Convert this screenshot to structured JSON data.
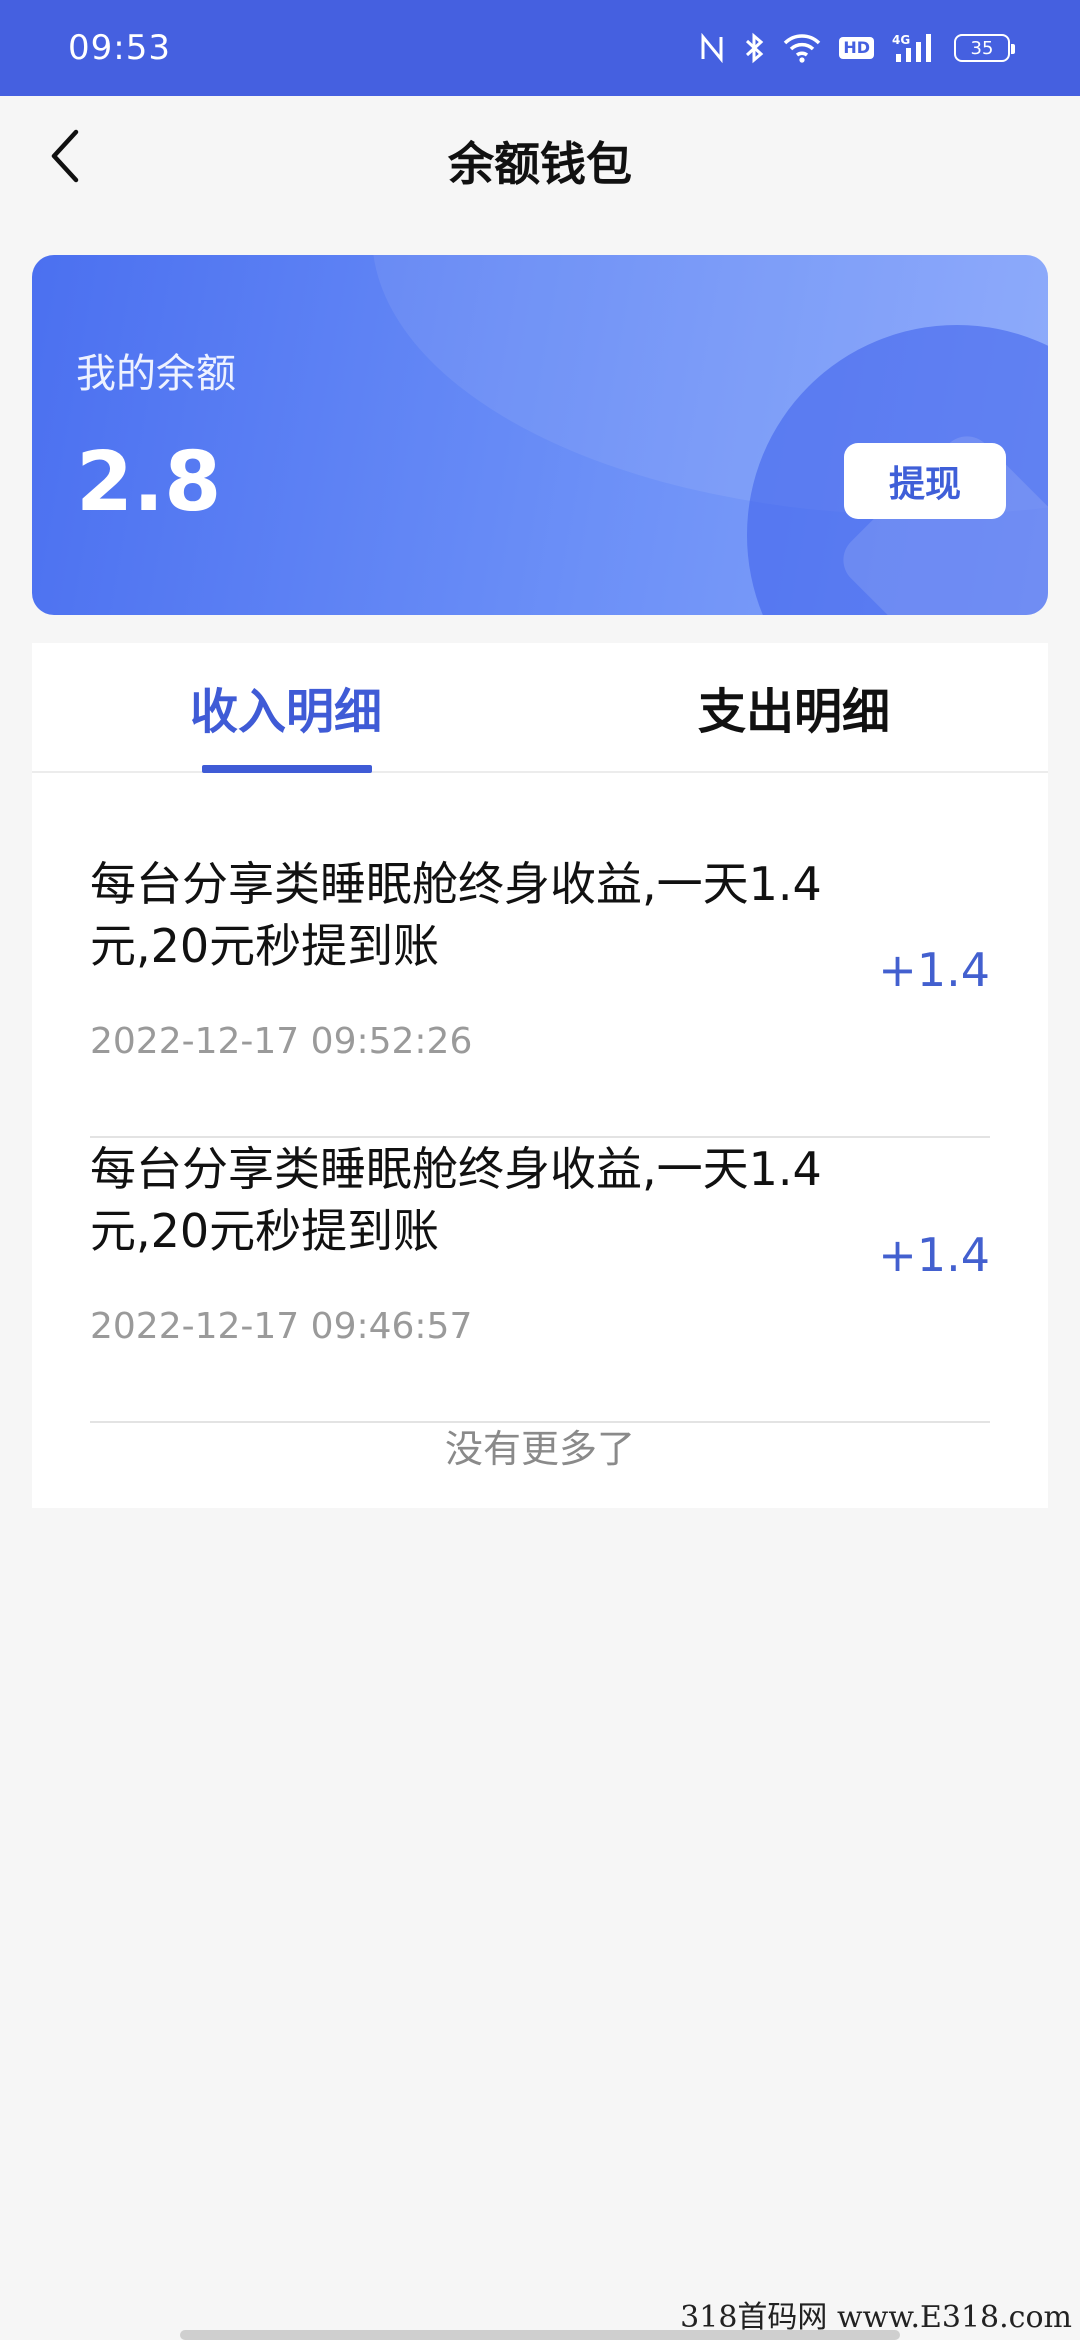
{
  "status_bar": {
    "time": "09:53",
    "icons": [
      "nfc-icon",
      "bluetooth-icon",
      "wifi-icon",
      "hd-icon",
      "signal-4g-icon",
      "battery-icon"
    ],
    "hd_label": "HD",
    "network_label": "4G",
    "battery_level": "35"
  },
  "header": {
    "title": "余额钱包",
    "back_icon": "chevron-left-icon"
  },
  "balance_card": {
    "label": "我的余额",
    "value": "2.8",
    "withdraw_label": "提现"
  },
  "tabs": [
    {
      "label": "收入明细",
      "active": true
    },
    {
      "label": "支出明细",
      "active": false
    }
  ],
  "records": [
    {
      "description": "每台分享类睡眠舱终身收益,一天1.4元,20元秒提到账",
      "time": "2022-12-17 09:52:26",
      "amount": "+1.4"
    },
    {
      "description": "每台分享类睡眠舱终身收益,一天1.4元,20元秒提到账",
      "time": "2022-12-17 09:46:57",
      "amount": "+1.4"
    }
  ],
  "footer_text": "没有更多了",
  "watermark": "318首码网 www.E318.com",
  "colors": {
    "status_bar": "#4560e0",
    "accent": "#3f5bd6",
    "card_gradient_start": "#4b70f0",
    "card_gradient_end": "#86a5fb"
  }
}
